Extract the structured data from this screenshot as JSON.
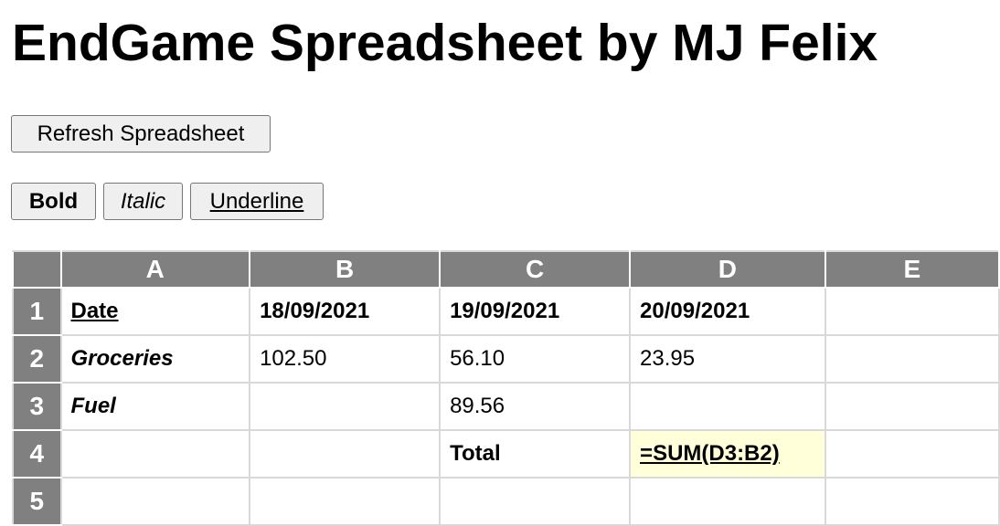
{
  "page": {
    "title": "EndGame Spreadsheet by MJ Felix"
  },
  "toolbar": {
    "refresh_label": "Refresh Spreadsheet",
    "bold_label": "Bold",
    "italic_label": "Italic",
    "underline_label": "Underline"
  },
  "sheet": {
    "columns": [
      "A",
      "B",
      "C",
      "D",
      "E"
    ],
    "rows": [
      {
        "num": "1",
        "cells": [
          {
            "value": "Date",
            "bold": true,
            "italic": false,
            "underline": true
          },
          {
            "value": "18/09/2021",
            "bold": true,
            "italic": false,
            "underline": false
          },
          {
            "value": "19/09/2021",
            "bold": true,
            "italic": false,
            "underline": false
          },
          {
            "value": "20/09/2021",
            "bold": true,
            "italic": false,
            "underline": false
          },
          {
            "value": "",
            "bold": false,
            "italic": false,
            "underline": false
          }
        ]
      },
      {
        "num": "2",
        "cells": [
          {
            "value": "Groceries",
            "bold": true,
            "italic": true,
            "underline": false
          },
          {
            "value": "102.50",
            "bold": false,
            "italic": false,
            "underline": false
          },
          {
            "value": "56.10",
            "bold": false,
            "italic": false,
            "underline": false
          },
          {
            "value": "23.95",
            "bold": false,
            "italic": false,
            "underline": false
          },
          {
            "value": "",
            "bold": false,
            "italic": false,
            "underline": false
          }
        ]
      },
      {
        "num": "3",
        "cells": [
          {
            "value": "Fuel",
            "bold": true,
            "italic": true,
            "underline": false
          },
          {
            "value": "",
            "bold": false,
            "italic": false,
            "underline": false
          },
          {
            "value": "89.56",
            "bold": false,
            "italic": false,
            "underline": false
          },
          {
            "value": "",
            "bold": false,
            "italic": false,
            "underline": false
          },
          {
            "value": "",
            "bold": false,
            "italic": false,
            "underline": false
          }
        ]
      },
      {
        "num": "4",
        "cells": [
          {
            "value": "",
            "bold": false,
            "italic": false,
            "underline": false
          },
          {
            "value": "",
            "bold": false,
            "italic": false,
            "underline": false
          },
          {
            "value": "Total",
            "bold": true,
            "italic": false,
            "underline": false
          },
          {
            "value": "=SUM(D3:B2)",
            "bold": true,
            "italic": false,
            "underline": true,
            "selected": true
          },
          {
            "value": "",
            "bold": false,
            "italic": false,
            "underline": false
          }
        ]
      },
      {
        "num": "5",
        "cells": [
          {
            "value": "",
            "bold": false,
            "italic": false,
            "underline": false
          },
          {
            "value": "",
            "bold": false,
            "italic": false,
            "underline": false
          },
          {
            "value": "",
            "bold": false,
            "italic": false,
            "underline": false
          },
          {
            "value": "",
            "bold": false,
            "italic": false,
            "underline": false
          },
          {
            "value": "",
            "bold": false,
            "italic": false,
            "underline": false
          }
        ]
      }
    ],
    "header_color": "#808080",
    "selected_cell_color": "#ffffd9",
    "grid_color": "#d9d9d9"
  }
}
